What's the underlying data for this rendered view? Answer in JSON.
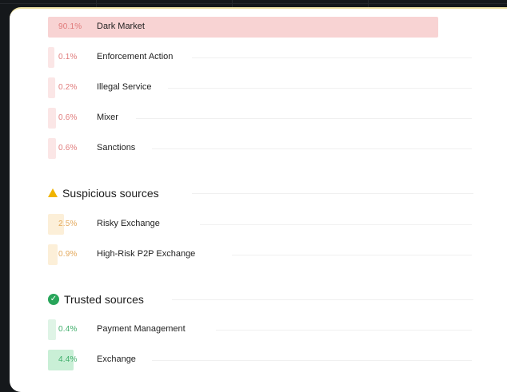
{
  "high_risk": [
    {
      "pct": "90.1%",
      "label": "Dark Market",
      "level": 0.901
    },
    {
      "pct": "0.1%",
      "label": "Enforcement Action",
      "level": 0.001
    },
    {
      "pct": "0.2%",
      "label": "Illegal Service",
      "level": 0.002
    },
    {
      "pct": "0.6%",
      "label": "Mixer",
      "level": 0.006
    },
    {
      "pct": "0.6%",
      "label": "Sanctions",
      "level": 0.006
    }
  ],
  "suspicious": {
    "title": "Suspicious sources",
    "icon": "warning-icon",
    "items": [
      {
        "pct": "2.5%",
        "label": "Risky Exchange",
        "level": 0.025
      },
      {
        "pct": "0.9%",
        "label": "High-Risk P2P Exchange",
        "level": 0.009
      }
    ]
  },
  "trusted": {
    "title": "Trusted sources",
    "icon": "check-circle-icon",
    "items": [
      {
        "pct": "0.4%",
        "label": "Payment Management",
        "level": 0.004
      },
      {
        "pct": "4.4%",
        "label": "Exchange",
        "level": 0.044
      }
    ]
  },
  "colors": {
    "high_bar": "#f8d3d3",
    "high_text": "#e07a7a",
    "warn_text": "#e3a85a",
    "ok_text": "#3fae6a",
    "ok_icon": "#28a55a",
    "warn_icon": "#f0b400"
  }
}
